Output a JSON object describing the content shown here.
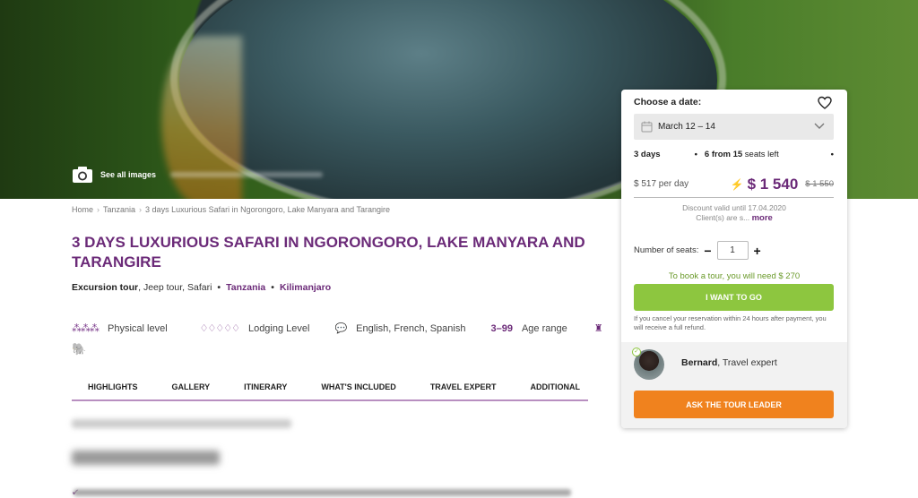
{
  "hero": {
    "see_all": "See all images"
  },
  "breadcrumb": {
    "items": [
      "Home",
      "Tanzania",
      "3 days Luxurious Safari in Ngorongoro, Lake Manyara and Tarangire"
    ],
    "separator": "›"
  },
  "tour": {
    "title": "3 days Luxurious Safari in Ngorongoro, Lake Manyara and Tarangire",
    "type_strong": "Excursion tour",
    "type_rest": ", Jeep tour, Safari",
    "country": "Tanzania",
    "region": "Kilimanjaro"
  },
  "features": {
    "physical_icons": "⁂⁂⁂",
    "physical_label": "Physical level",
    "lodging_icons": "♢♢♢♢♢",
    "lodging_label": "Lodging Level",
    "languages": "English, French, Spanish",
    "age_range": "3–99",
    "age_label": "Age range"
  },
  "tabs": [
    "HIGHLIGHTS",
    "GALLERY",
    "ITINERARY",
    "WHAT'S INCLUDED",
    "TRAVEL EXPERT",
    "ADDITIONAL"
  ],
  "booking": {
    "choose_label": "Choose a date:",
    "date_value": "March 12 – 14",
    "days": "3 days",
    "seats_from": "6 from 15",
    "seats_left": "seats left",
    "per_day": "$ 517 per day",
    "price": "$ 1 540",
    "old_price": "$ 1 550",
    "discount_line": "Discount valid until 17.04.2020",
    "clients_line": "Client(s) are s...",
    "more": "more",
    "seats_label": "Number of seats:",
    "seats_value": "1",
    "book_note": "To book a tour, you will need $ 270",
    "want_button": "I WANT TO GO",
    "refund_note": "If you cancel your reservation within 24 hours after payment, you will receive a full refund."
  },
  "expert": {
    "name": "Bernard",
    "role": ", Travel expert",
    "ask_button": "ASK THE TOUR LEADER"
  },
  "colors": {
    "accent_purple": "#6b2a78",
    "green": "#8dc63f",
    "orange": "#f0821e"
  }
}
